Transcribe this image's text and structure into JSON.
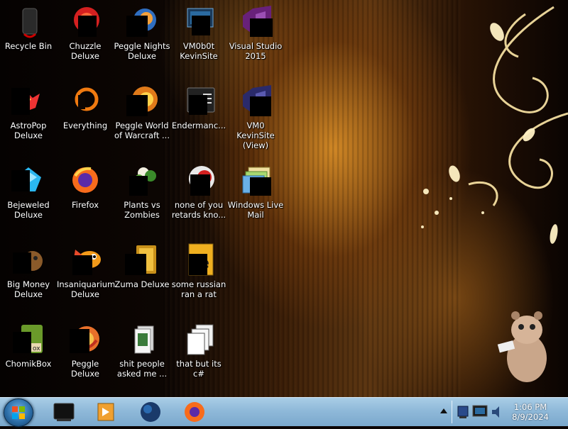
{
  "desktop": {
    "icons": [
      {
        "label": "Recycle Bin",
        "icon": "recycle-bin-icon"
      },
      {
        "label": "Chuzzle Deluxe",
        "icon": "chuzzle-icon"
      },
      {
        "label": "Peggle Nights Deluxe",
        "icon": "peggle-nights-icon"
      },
      {
        "label": "VM0b0t KevinSite",
        "icon": "vm-shortcut-icon"
      },
      {
        "label": "Visual Studio 2015",
        "icon": "visual-studio-icon"
      },
      {
        "label": "AstroPop Deluxe",
        "icon": "astropop-icon"
      },
      {
        "label": "Everything",
        "icon": "everything-search-icon"
      },
      {
        "label": "Peggle World of Warcraft ...",
        "icon": "peggle-wow-icon"
      },
      {
        "label": "Endermanc...",
        "icon": "terminal-icon"
      },
      {
        "label": "VM0 KevinSite (View)",
        "icon": "visual-studio-icon"
      },
      {
        "label": "Bejeweled Deluxe",
        "icon": "bejeweled-icon"
      },
      {
        "label": "Firefox",
        "icon": "firefox-icon"
      },
      {
        "label": "Plants vs Zombies",
        "icon": "plants-vs-zombies-icon"
      },
      {
        "label": "none of you retards kno...",
        "icon": "chuzzle-icon"
      },
      {
        "label": "Windows Live Mail",
        "icon": "windows-live-mail-icon"
      },
      {
        "label": "Big Money Deluxe",
        "icon": "big-money-icon"
      },
      {
        "label": "Insaniquarium Deluxe",
        "icon": "insaniquarium-icon"
      },
      {
        "label": "Zuma Deluxe",
        "icon": "zuma-icon"
      },
      {
        "label": "some russian ran a rat",
        "icon": "document-icon"
      },
      {
        "label": "ChomikBox",
        "icon": "chomikbox-icon"
      },
      {
        "label": "Peggle Deluxe",
        "icon": "peggle-icon"
      },
      {
        "label": "shit people asked me ...",
        "icon": "folder-icon"
      },
      {
        "label": "that but its c#",
        "icon": "files-icon"
      }
    ]
  },
  "taskbar": {
    "start_icon": "windows-start-icon",
    "pinned": [
      {
        "icon": "taskbar-app-black-icon"
      },
      {
        "icon": "media-player-icon"
      },
      {
        "icon": "globe-icon"
      },
      {
        "icon": "firefox-icon"
      }
    ],
    "tray": {
      "show_hidden_icon": "up-arrow-icon",
      "icons": [
        "network-icon",
        "monitor-icon",
        "speaker-icon"
      ],
      "time": "1:06 PM",
      "date": "8/9/2024"
    }
  }
}
